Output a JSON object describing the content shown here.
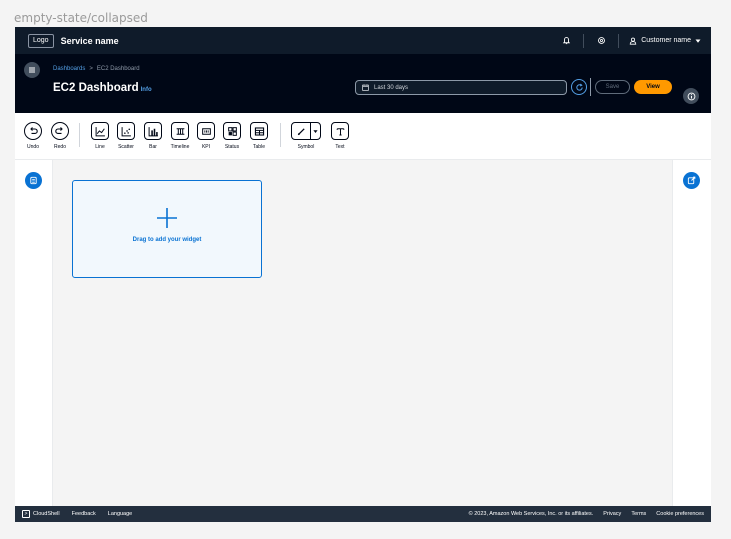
{
  "state_label": "empty-state/collapsed",
  "topnav": {
    "logo": "Logo",
    "service_name": "Service name",
    "user_name": "Customer name",
    "icons": [
      "notifications-icon",
      "settings-icon",
      "user-icon",
      "caret-down-icon"
    ]
  },
  "header": {
    "breadcrumb": [
      "Dashboards",
      "EC2 Dashboard"
    ],
    "title": "EC2 Dashboard",
    "info": "Info",
    "date_range": "Last 30 days",
    "save_label": "Save",
    "view_label": "View"
  },
  "toolbar": {
    "tools": [
      {
        "label": "Undo",
        "icon": "undo-icon"
      },
      {
        "label": "Redo",
        "icon": "redo-icon"
      },
      {
        "label": "Line",
        "icon": "line-chart-icon"
      },
      {
        "label": "Scatter",
        "icon": "scatter-chart-icon"
      },
      {
        "label": "Bar",
        "icon": "bar-chart-icon"
      },
      {
        "label": "Timeline",
        "icon": "timeline-icon"
      },
      {
        "label": "KPI",
        "icon": "kpi-icon"
      },
      {
        "label": "Status",
        "icon": "status-icon"
      },
      {
        "label": "Table",
        "icon": "table-icon"
      },
      {
        "label": "Symbol",
        "icon": "symbol-icon"
      },
      {
        "label": "Text",
        "icon": "text-icon"
      }
    ]
  },
  "canvas": {
    "dropzone_text": "Drag to add your widget"
  },
  "footer": {
    "cloudshell": "CloudShell",
    "feedback": "Feedback",
    "language": "Language",
    "copyright": "© 2023, Amazon Web Services, Inc. or its affiliates.",
    "privacy": "Privacy",
    "terms": "Terms",
    "cookies": "Cookie preferences"
  },
  "colors": {
    "nav_bg": "#0f1b2a",
    "header_bg": "#000716",
    "accent_blue": "#0972d3",
    "link_blue": "#539fe5",
    "primary_orange": "#ff9900",
    "footer_bg": "#232f3e"
  }
}
